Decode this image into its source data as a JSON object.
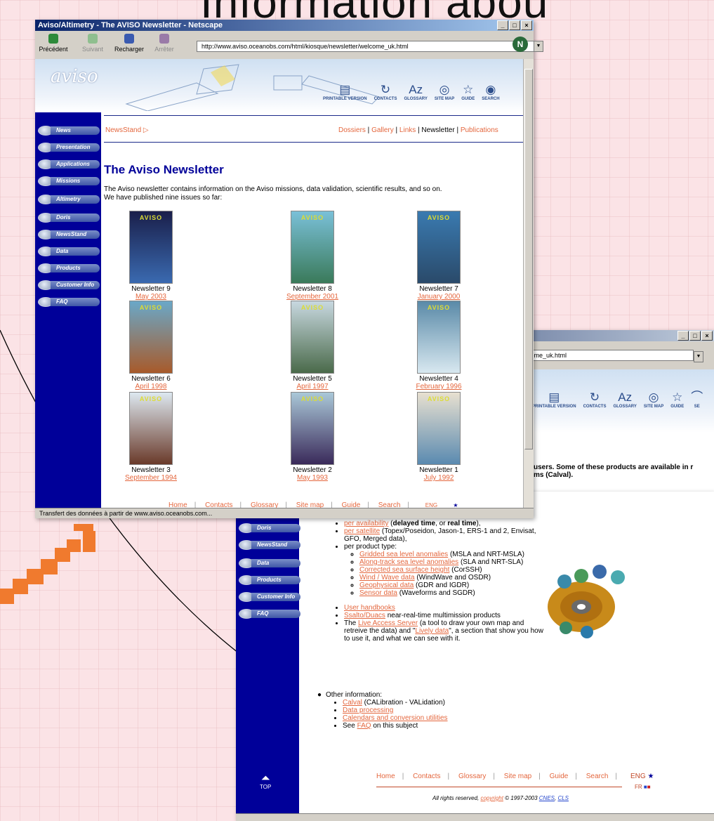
{
  "slide": {
    "title": "Information abou"
  },
  "front": {
    "window_title": "Aviso/Altimetry - The AVISO Newsletter - Netscape",
    "toolbar": [
      {
        "label": "Précédent",
        "dim": false
      },
      {
        "label": "Suivant",
        "dim": true
      },
      {
        "label": "Recharger",
        "dim": false
      },
      {
        "label": "Arrêter",
        "dim": true
      }
    ],
    "url": "http://www.aviso.oceanobs.com/html/kiosque/newsletter/welcome_uk.html",
    "status": "Transfert des données à partir de www.aviso.oceanobs.com...",
    "logo": "aviso",
    "nav_icons": [
      "PRINTABLE VERSION",
      "CONTACTS",
      "GLOSSARY",
      "SITE MAP",
      "GUIDE",
      "SEARCH"
    ],
    "sidebar": [
      "News",
      "Presentation",
      "Applications",
      "Missions",
      "Altimetry",
      "Doris",
      "NewsStand",
      "Data",
      "Products",
      "Customer Info",
      "FAQ"
    ],
    "breadcrumb": "NewsStand",
    "section_links": {
      "dossiers": "Dossiers",
      "gallery": "Gallery",
      "links": "Links",
      "newsletter": "Newsletter",
      "publications": "Publications"
    },
    "heading": "The Aviso Newsletter",
    "intro_1": "The Aviso newsletter contains information on the Aviso missions, data validation, scientific results, and so on.",
    "intro_2": "We have published nine issues so far:",
    "cover_header": "AVISO",
    "issues": [
      {
        "name": "Newsletter 9",
        "date": "May 2003"
      },
      {
        "name": "Newsletter 8",
        "date": "September 2001"
      },
      {
        "name": "Newsletter 7",
        "date": "January 2000"
      },
      {
        "name": "Newsletter 6",
        "date": "April 1998"
      },
      {
        "name": "Newsletter 5",
        "date": "April 1997"
      },
      {
        "name": "Newsletter 4",
        "date": "February 1996"
      },
      {
        "name": "Newsletter 3",
        "date": "September 1994"
      },
      {
        "name": "Newsletter 2",
        "date": "May 1993"
      },
      {
        "name": "Newsletter 1",
        "date": "July 1992"
      }
    ],
    "footer": [
      "Home",
      "Contacts",
      "Glossary",
      "Site map",
      "Guide",
      "Search"
    ],
    "footer_lang": "ENG"
  },
  "back": {
    "url": "lcome_uk.html",
    "nav_icons": [
      "PRINTABLE VERSION",
      "CONTACTS",
      "GLOSSARY",
      "SITE MAP",
      "GUIDE",
      "SE"
    ],
    "text_1": "users. Some of these products are available in r",
    "text_2": "ms (Calval).",
    "sidebar": [
      "Doris",
      "NewsStand",
      "Data",
      "Products",
      "Customer Info",
      "FAQ"
    ],
    "top_label": "TOP",
    "items": {
      "availability_link": "per availability",
      "availability_text_1": " (",
      "delayed": "delayed time",
      "availability_text_2": ", or ",
      "realtime": "real time",
      "availability_text_3": "),",
      "satellite_link": "per satellite",
      "satellite_text": " (Topex/Poseidon, Jason-1, ERS-1 and 2, Envisat, GFO, Merged data),",
      "product_type": "per product type:",
      "products": [
        {
          "link": "Gridded sea level anomalies",
          "text": " (MSLA and NRT-MSLA)"
        },
        {
          "link": "Along-track sea level anomalies",
          "text": " (SLA and NRT-SLA)"
        },
        {
          "link": "Corrected sea surface height",
          "text": " (CorSSH)"
        },
        {
          "link": "Wind / Wave data",
          "text": " (WindWave and OSDR)"
        },
        {
          "link": "Geophysical data",
          "text": " (GDR and IGDR)"
        },
        {
          "link": "Sensor data",
          "text": " (Waveforms and SGDR)"
        }
      ],
      "handbooks": "User handbooks",
      "ssalto_link": "Ssalto/Duacs",
      "ssalto_text": " near-real-time multimission products",
      "las_1": "The ",
      "las_link": "Live Access Server",
      "las_2": " (a tool to draw your own map and retreive the data) and \"",
      "lively_link": "Lively data",
      "las_3": "\", a section that show you how to use it, and what we can see with it.",
      "other": "Other information:",
      "calval_link": "Calval",
      "calval_text": " (CALibration - VALidation)",
      "processing": "Data processing",
      "calendars": "Calendars and conversion utilities",
      "see_1": "See ",
      "faq_link": "FAQ",
      "see_2": " on this subject"
    },
    "footer": [
      "Home",
      "Contacts",
      "Glossary",
      "Site map",
      "Guide",
      "Search"
    ],
    "lang_eng": "ENG",
    "lang_fr": "FR",
    "copyright_1": "All rights reserved, ",
    "copyright_link": "copyright",
    "copyright_2": " © 1997-2003 ",
    "cnes": "CNES",
    "cls": "CLS"
  }
}
